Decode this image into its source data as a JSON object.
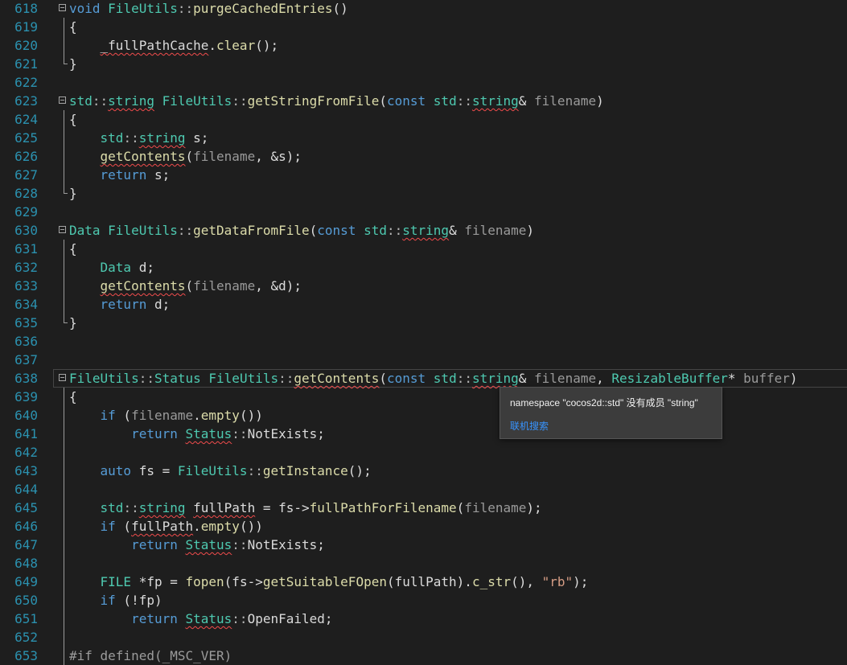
{
  "tooltip": {
    "message": "namespace \"cocos2d::std\" 没有成员 \"string\"",
    "link": "联机搜索"
  },
  "lines": [
    {
      "num": "618",
      "fold": true,
      "tokens": [
        [
          "void",
          "kw"
        ],
        [
          " ",
          ""
        ],
        [
          "FileUtils",
          "type"
        ],
        [
          "::",
          "op"
        ],
        [
          "purgeCachedEntries",
          "fn"
        ],
        [
          "()",
          ""
        ]
      ]
    },
    {
      "num": "619",
      "guide": true,
      "tokens": [
        [
          "{",
          ""
        ]
      ]
    },
    {
      "num": "620",
      "guide": true,
      "tokens": [
        [
          "    ",
          ""
        ],
        [
          "_fullPathCache",
          "member",
          "err"
        ],
        [
          ".",
          ""
        ],
        [
          "clear",
          "fn"
        ],
        [
          "();",
          ""
        ]
      ]
    },
    {
      "num": "621",
      "guideEnd": true,
      "tokens": [
        [
          "}",
          ""
        ]
      ]
    },
    {
      "num": "622",
      "tokens": []
    },
    {
      "num": "623",
      "fold": true,
      "tokens": [
        [
          "std",
          "type"
        ],
        [
          "::",
          "op"
        ],
        [
          "string",
          "type",
          "err"
        ],
        [
          " ",
          ""
        ],
        [
          "FileUtils",
          "type"
        ],
        [
          "::",
          "op"
        ],
        [
          "getStringFromFile",
          "fn"
        ],
        [
          "(",
          ""
        ],
        [
          "const",
          "kw"
        ],
        [
          " ",
          ""
        ],
        [
          "std",
          "type"
        ],
        [
          "::",
          "op"
        ],
        [
          "string",
          "type",
          "err"
        ],
        [
          "& ",
          ""
        ],
        [
          "filename",
          "param"
        ],
        [
          ")",
          ""
        ]
      ]
    },
    {
      "num": "624",
      "guide": true,
      "tokens": [
        [
          "{",
          ""
        ]
      ]
    },
    {
      "num": "625",
      "guide": true,
      "tokens": [
        [
          "    ",
          ""
        ],
        [
          "std",
          "type"
        ],
        [
          "::",
          "op"
        ],
        [
          "string",
          "type",
          "err"
        ],
        [
          " s;",
          ""
        ]
      ]
    },
    {
      "num": "626",
      "guide": true,
      "tokens": [
        [
          "    ",
          ""
        ],
        [
          "getContents",
          "fn",
          "err"
        ],
        [
          "(",
          ""
        ],
        [
          "filename",
          "param"
        ],
        [
          ", &s);",
          ""
        ]
      ]
    },
    {
      "num": "627",
      "guide": true,
      "tokens": [
        [
          "    ",
          ""
        ],
        [
          "return",
          "kw"
        ],
        [
          " s;",
          ""
        ]
      ]
    },
    {
      "num": "628",
      "guideEnd": true,
      "tokens": [
        [
          "}",
          ""
        ]
      ]
    },
    {
      "num": "629",
      "tokens": []
    },
    {
      "num": "630",
      "fold": true,
      "tokens": [
        [
          "Data",
          "type"
        ],
        [
          " ",
          ""
        ],
        [
          "FileUtils",
          "type"
        ],
        [
          "::",
          "op"
        ],
        [
          "getDataFromFile",
          "fn"
        ],
        [
          "(",
          ""
        ],
        [
          "const",
          "kw"
        ],
        [
          " ",
          ""
        ],
        [
          "std",
          "type"
        ],
        [
          "::",
          "op"
        ],
        [
          "string",
          "type",
          "err"
        ],
        [
          "& ",
          ""
        ],
        [
          "filename",
          "param"
        ],
        [
          ")",
          ""
        ]
      ]
    },
    {
      "num": "631",
      "guide": true,
      "tokens": [
        [
          "{",
          ""
        ]
      ]
    },
    {
      "num": "632",
      "guide": true,
      "tokens": [
        [
          "    ",
          ""
        ],
        [
          "Data",
          "type"
        ],
        [
          " d;",
          ""
        ]
      ]
    },
    {
      "num": "633",
      "guide": true,
      "tokens": [
        [
          "    ",
          ""
        ],
        [
          "getContents",
          "fn",
          "err"
        ],
        [
          "(",
          ""
        ],
        [
          "filename",
          "param"
        ],
        [
          ", &d);",
          ""
        ]
      ]
    },
    {
      "num": "634",
      "guide": true,
      "tokens": [
        [
          "    ",
          ""
        ],
        [
          "return",
          "kw"
        ],
        [
          " d;",
          ""
        ]
      ]
    },
    {
      "num": "635",
      "guideEnd": true,
      "tokens": [
        [
          "}",
          ""
        ]
      ]
    },
    {
      "num": "636",
      "tokens": []
    },
    {
      "num": "637",
      "tokens": []
    },
    {
      "num": "638",
      "fold": true,
      "current": true,
      "tokens": [
        [
          "FileUtils",
          "type"
        ],
        [
          "::",
          "op"
        ],
        [
          "Status",
          "type"
        ],
        [
          " ",
          ""
        ],
        [
          "FileUtils",
          "type"
        ],
        [
          "::",
          "op"
        ],
        [
          "getContents",
          "fn",
          "err"
        ],
        [
          "(",
          ""
        ],
        [
          "const",
          "kw"
        ],
        [
          " ",
          ""
        ],
        [
          "std",
          "type"
        ],
        [
          "::",
          "op"
        ],
        [
          "string",
          "type",
          "err"
        ],
        [
          "& ",
          ""
        ],
        [
          "filename",
          "param"
        ],
        [
          ", ",
          ""
        ],
        [
          "ResizableBuffer",
          "type"
        ],
        [
          "* ",
          ""
        ],
        [
          "buffer",
          "param"
        ],
        [
          ")",
          ""
        ]
      ]
    },
    {
      "num": "639",
      "guide": true,
      "tokens": [
        [
          "{",
          ""
        ]
      ]
    },
    {
      "num": "640",
      "guide": true,
      "tokens": [
        [
          "    ",
          ""
        ],
        [
          "if",
          "kw"
        ],
        [
          " (",
          ""
        ],
        [
          "filename",
          "param"
        ],
        [
          ".",
          ""
        ],
        [
          "empty",
          "fn"
        ],
        [
          "())",
          ""
        ]
      ]
    },
    {
      "num": "641",
      "guide": true,
      "tokens": [
        [
          "        ",
          ""
        ],
        [
          "return",
          "kw"
        ],
        [
          " ",
          ""
        ],
        [
          "Status",
          "type",
          "err"
        ],
        [
          "::",
          "op"
        ],
        [
          "NotExists",
          "member"
        ],
        [
          ";",
          ""
        ]
      ]
    },
    {
      "num": "642",
      "guide": true,
      "tokens": []
    },
    {
      "num": "643",
      "guide": true,
      "tokens": [
        [
          "    ",
          ""
        ],
        [
          "auto",
          "kw"
        ],
        [
          " fs = ",
          ""
        ],
        [
          "FileUtils",
          "type"
        ],
        [
          "::",
          "op"
        ],
        [
          "getInstance",
          "fn"
        ],
        [
          "();",
          ""
        ]
      ]
    },
    {
      "num": "644",
      "guide": true,
      "tokens": []
    },
    {
      "num": "645",
      "guide": true,
      "tokens": [
        [
          "    ",
          ""
        ],
        [
          "std",
          "type"
        ],
        [
          "::",
          "op"
        ],
        [
          "string",
          "type",
          "err"
        ],
        [
          " ",
          ""
        ],
        [
          "fullPath",
          "var",
          "err"
        ],
        [
          " = fs->",
          ""
        ],
        [
          "fullPathForFilename",
          "fn"
        ],
        [
          "(",
          ""
        ],
        [
          "filename",
          "param"
        ],
        [
          ");",
          ""
        ]
      ]
    },
    {
      "num": "646",
      "guide": true,
      "tokens": [
        [
          "    ",
          ""
        ],
        [
          "if",
          "kw"
        ],
        [
          " (",
          ""
        ],
        [
          "fullPath",
          "var",
          "err"
        ],
        [
          ".",
          ""
        ],
        [
          "empty",
          "fn"
        ],
        [
          "())",
          ""
        ]
      ]
    },
    {
      "num": "647",
      "guide": true,
      "tokens": [
        [
          "        ",
          ""
        ],
        [
          "return",
          "kw"
        ],
        [
          " ",
          ""
        ],
        [
          "Status",
          "type",
          "err"
        ],
        [
          "::",
          "op"
        ],
        [
          "NotExists",
          "member"
        ],
        [
          ";",
          ""
        ]
      ]
    },
    {
      "num": "648",
      "guide": true,
      "tokens": []
    },
    {
      "num": "649",
      "guide": true,
      "tokens": [
        [
          "    ",
          ""
        ],
        [
          "FILE",
          "type"
        ],
        [
          " *fp = ",
          ""
        ],
        [
          "fopen",
          "fn"
        ],
        [
          "(fs->",
          ""
        ],
        [
          "getSuitableFOpen",
          "fn"
        ],
        [
          "(",
          ""
        ],
        [
          "fullPath",
          "var"
        ],
        [
          ").",
          ""
        ],
        [
          "c_str",
          "fn"
        ],
        [
          "(), ",
          ""
        ],
        [
          "\"rb\"",
          "str"
        ],
        [
          ");",
          ""
        ]
      ]
    },
    {
      "num": "650",
      "guide": true,
      "tokens": [
        [
          "    ",
          ""
        ],
        [
          "if",
          "kw"
        ],
        [
          " (!fp)",
          ""
        ]
      ]
    },
    {
      "num": "651",
      "guide": true,
      "tokens": [
        [
          "        ",
          ""
        ],
        [
          "return",
          "kw"
        ],
        [
          " ",
          ""
        ],
        [
          "Status",
          "type",
          "err"
        ],
        [
          "::",
          "op"
        ],
        [
          "OpenFailed",
          "member"
        ],
        [
          ";",
          ""
        ]
      ]
    },
    {
      "num": "652",
      "guide": true,
      "tokens": []
    },
    {
      "num": "653",
      "guide": true,
      "tokens": [
        [
          "#if defined(_MSC_VER)",
          "pp"
        ]
      ]
    }
  ]
}
